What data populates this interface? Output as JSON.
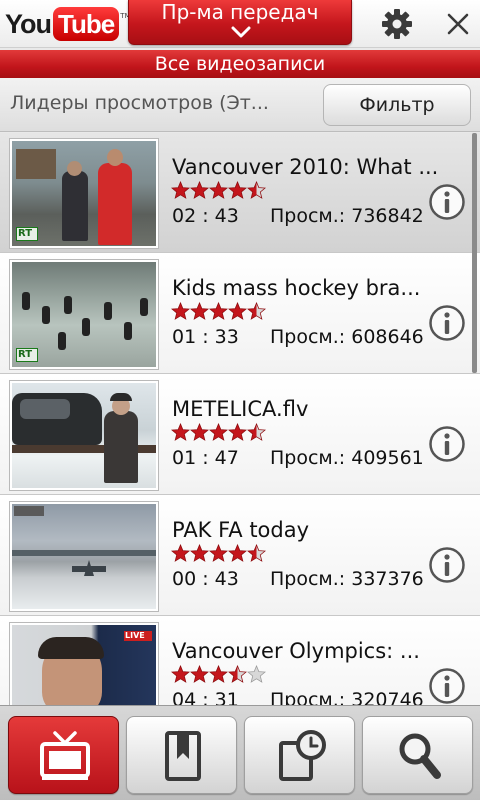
{
  "header": {
    "logo_you": "You",
    "logo_tube": "Tube",
    "logo_tm": "TM",
    "category_label": "Пр-ма передач",
    "accent_color": "#c4161c"
  },
  "title_strip": "Все видеозаписи",
  "sortbar": {
    "sort_label": "Лидеры просмотров (Эт...",
    "filter_label": "Фильтр"
  },
  "videos": [
    {
      "title": "Vancouver 2010: What ...",
      "rating": 4.5,
      "duration": "02 : 43",
      "views": "Просм.: 736842",
      "selected": true
    },
    {
      "title": "Kids mass hockey bra...",
      "rating": 4.5,
      "duration": "01 : 33",
      "views": "Просм.: 608646",
      "selected": false
    },
    {
      "title": "METELICA.flv",
      "rating": 4.5,
      "duration": "01 : 47",
      "views": "Просм.: 409561",
      "selected": false
    },
    {
      "title": "PAK FA today",
      "rating": 4.5,
      "duration": "00 : 43",
      "views": "Просм.: 337376",
      "selected": false
    },
    {
      "title": "Vancouver Olympics: ...",
      "rating": 3.5,
      "duration": "04 : 31",
      "views": "Просм.: 320746",
      "selected": false
    }
  ],
  "thumbnail_badges": [
    "RT",
    "RT",
    "",
    "",
    "LIVE"
  ],
  "icons": {
    "category": "chevron-down-icon",
    "settings": "gear-icon",
    "close": "close-icon",
    "info": "info-icon",
    "nav": [
      "tv-icon",
      "bookmark-icon",
      "history-icon",
      "search-icon"
    ]
  }
}
